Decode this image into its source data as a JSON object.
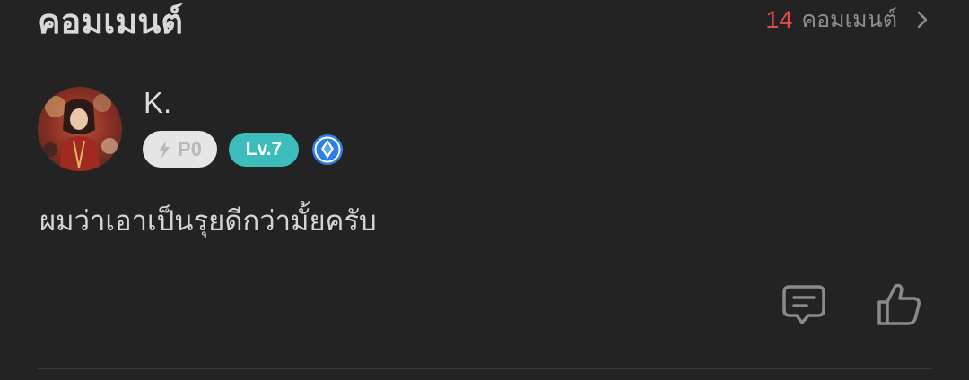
{
  "header": {
    "title": "คอมเมนต์",
    "count": "14",
    "count_label": "คอมเมนต์"
  },
  "comment": {
    "username": "K.",
    "badge_p_label": "P0",
    "badge_level_label": "Lv.7",
    "text": "ผมว่าเอาเป็นรุยดีกว่ามั้ยครับ"
  },
  "icons": {
    "chevron": "chevron-right-icon",
    "bolt": "lightning-bolt-icon",
    "gem": "diamond-badge-icon",
    "reply": "comment-bubble-icon",
    "like": "thumbs-up-icon"
  },
  "colors": {
    "background": "#232323",
    "count_accent": "#e5484d",
    "level_badge": "#3cbcba",
    "gem_blue": "#2f7fe0"
  }
}
